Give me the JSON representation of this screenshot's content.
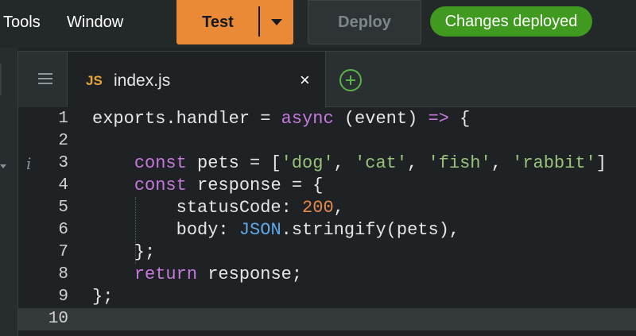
{
  "menu": {
    "tools": "Tools",
    "window": "Window"
  },
  "toolbar": {
    "test_label": "Test",
    "deploy_label": "Deploy",
    "status_badge": "Changes deployed",
    "colors": {
      "test": "#ea8a37",
      "badge": "#3f9a1f"
    }
  },
  "editor": {
    "tab": {
      "icon_text": "JS",
      "title": "index.js",
      "close": "×"
    },
    "info_marker": "i",
    "active_line": 10,
    "lines": [
      {
        "num": "1",
        "text": "exports.handler = async (event) => {"
      },
      {
        "num": "2",
        "text": ""
      },
      {
        "num": "3",
        "text": "    const pets = ['dog', 'cat', 'fish', 'rabbit']"
      },
      {
        "num": "4",
        "text": "    const response = {"
      },
      {
        "num": "5",
        "text": "        statusCode: 200,"
      },
      {
        "num": "6",
        "text": "        body: JSON.stringify(pets),"
      },
      {
        "num": "7",
        "text": "    };"
      },
      {
        "num": "8",
        "text": "    return response;"
      },
      {
        "num": "9",
        "text": "};"
      },
      {
        "num": "10",
        "text": ""
      }
    ]
  }
}
